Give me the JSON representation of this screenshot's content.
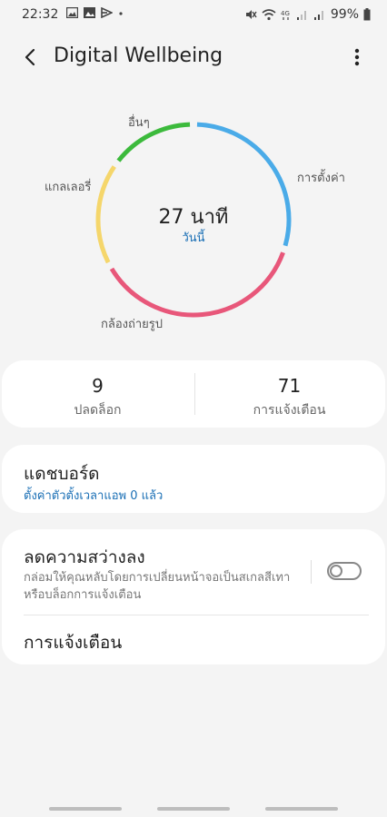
{
  "status_bar": {
    "time": "22:32",
    "notification_icons": [
      "gallery-icon",
      "image-icon",
      "flipboard-icon",
      "dot-icon"
    ],
    "system_icons": [
      "mute-icon",
      "wifi-icon",
      "4g-icon",
      "signal-icon",
      "signal-icon",
      "battery-icon"
    ],
    "battery": "99%"
  },
  "app_bar": {
    "title": "Digital Wellbeing"
  },
  "usage_chart": {
    "total": "27 นาที",
    "period": "วันนี้",
    "segments": [
      {
        "label": "การตั้งค่า",
        "share": 0.3,
        "color": "#4aabe8"
      },
      {
        "label": "กล้องถ่ายรูป",
        "share": 0.37,
        "color": "#e8577a"
      },
      {
        "label": "แกลเลอรี่",
        "share": 0.18,
        "color": "#f5d66b"
      },
      {
        "label": "อื่นๆ",
        "share": 0.15,
        "color": "#3cba3c"
      }
    ]
  },
  "stats": {
    "unlocks": {
      "value": "9",
      "label": "ปลดล็อก"
    },
    "notifications": {
      "value": "71",
      "label": "การแจ้งเตือน"
    }
  },
  "dashboard": {
    "title": "แดชบอร์ด",
    "subtitle": "ตั้งค่าตัวตั้งเวลาแอพ 0 แล้ว"
  },
  "wind_down": {
    "title": "ลดความสว่างลง",
    "description": "กล่อมให้คุณหลับโดยการเปลี่ยนหน้าจอเป็นสเกลสีเทาหรือบล็อกการแจ้งเตือน",
    "enabled": false
  },
  "notifications_row": {
    "label": "การแจ้งเตือน"
  }
}
